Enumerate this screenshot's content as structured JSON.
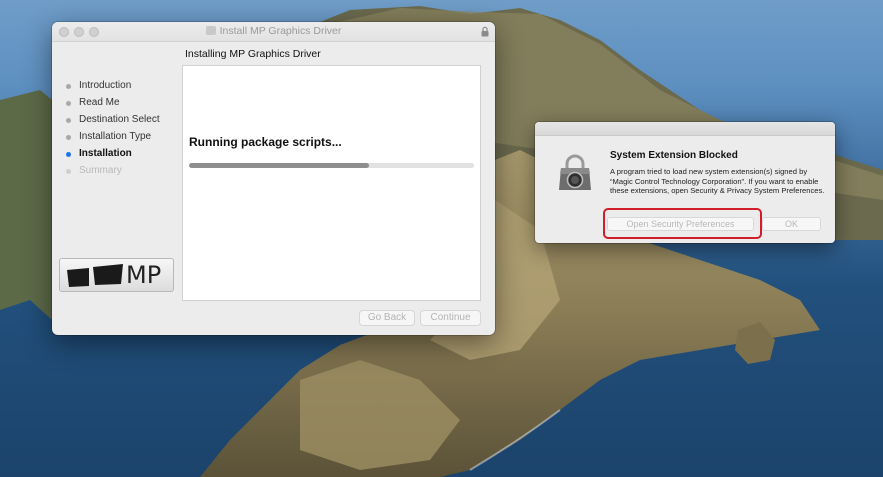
{
  "installer": {
    "title": "Install MP Graphics Driver",
    "subtitle": "Installing MP Graphics Driver",
    "steps": [
      {
        "label": "Introduction"
      },
      {
        "label": "Read Me"
      },
      {
        "label": "Destination Select"
      },
      {
        "label": "Installation Type"
      },
      {
        "label": "Installation"
      },
      {
        "label": "Summary"
      }
    ],
    "status_text": "Running package scripts...",
    "progress": 0.63,
    "logo_text": "MP",
    "go_back_label": "Go Back",
    "continue_label": "Continue"
  },
  "alert": {
    "title": "System Extension Blocked",
    "message": "A program tried to load new system extension(s) signed by “Magic Control Technology Corporation”. If you want to enable these extensions, open Security & Privacy System Preferences.",
    "open_security_label": "Open Security Preferences",
    "ok_label": "OK"
  },
  "colors": {
    "active_step": "#1c74e8",
    "highlight": "#d21e2a",
    "progress_fill": "#8d8d8d"
  }
}
